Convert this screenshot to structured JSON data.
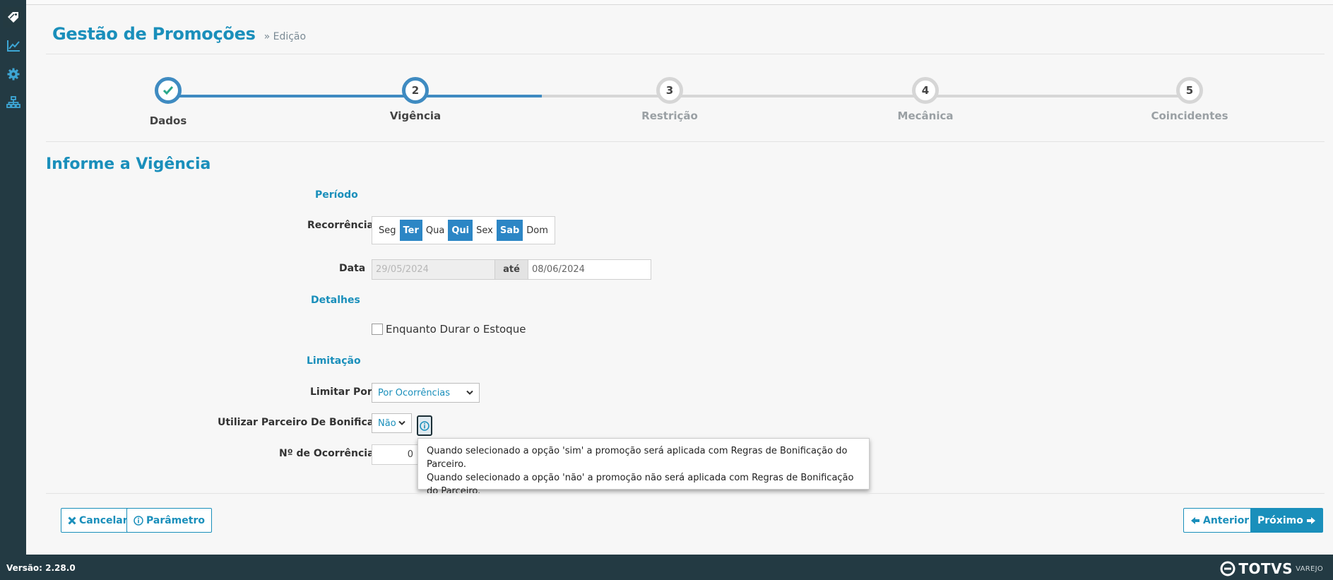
{
  "page": {
    "title": "Gestão de Promoções",
    "subtitle": "» Edição"
  },
  "sidebar": {
    "items": [
      {
        "icon": "tag-icon",
        "active": true
      },
      {
        "icon": "line-chart-icon",
        "active": false
      },
      {
        "icon": "gear-icon",
        "active": false
      },
      {
        "icon": "sitemap-icon",
        "active": false
      }
    ]
  },
  "stepper": {
    "steps": [
      {
        "number": "✔",
        "label": "Dados",
        "state": "done"
      },
      {
        "number": "2",
        "label": "Vigência",
        "state": "current"
      },
      {
        "number": "3",
        "label": "Restrição",
        "state": "pending"
      },
      {
        "number": "4",
        "label": "Mecânica",
        "state": "pending"
      },
      {
        "number": "5",
        "label": "Coincidentes",
        "state": "pending"
      }
    ],
    "colors": {
      "done": "#3f8bc1",
      "pending": "#d6d6d6"
    }
  },
  "form": {
    "section_title": "Informe a Vigência",
    "periodo_title": "Período",
    "recorrencia_label": "Recorrência",
    "days": [
      {
        "label": "Seg",
        "selected": false
      },
      {
        "label": "Ter",
        "selected": true
      },
      {
        "label": "Qua",
        "selected": false
      },
      {
        "label": "Qui",
        "selected": true
      },
      {
        "label": "Sex",
        "selected": false
      },
      {
        "label": "Sab",
        "selected": true
      },
      {
        "label": "Dom",
        "selected": false
      }
    ],
    "data_label": "Data",
    "date_start": "29/05/2024",
    "date_sep": "até",
    "date_end": "08/06/2024",
    "detalhes_title": "Detalhes",
    "estoque_label": "Enquanto Durar o Estoque",
    "estoque_checked": false,
    "limitacao_title": "Limitação",
    "limitar_label": "Limitar Por",
    "limitar_value": "Por Ocorrências",
    "parceiro_label": "Utilizar Parceiro De Bonificação",
    "parceiro_value": "Não",
    "ocorrencias_label": "Nº de Ocorrências",
    "ocorrencias_value": "0"
  },
  "tooltip": {
    "line1": "Quando selecionado a opção 'sim' a promoção será aplicada com Regras de Bonificação do Parceiro.",
    "line2": "Quando selecionado a opção 'não' a promoção não será aplicada com Regras de Bonificação do Parceiro."
  },
  "buttons": {
    "cancel": "Cancelar",
    "param": "Parâmetro",
    "prev": "Anterior",
    "next": "Próximo"
  },
  "footer": {
    "version": "Versão: 2.28.0",
    "brand": "TOTVS",
    "brand_sub": "VAREJO"
  },
  "colors": {
    "accent": "#1a8fbb",
    "sidebar_bg": "#233a43",
    "selected_day": "#2c86c5"
  }
}
